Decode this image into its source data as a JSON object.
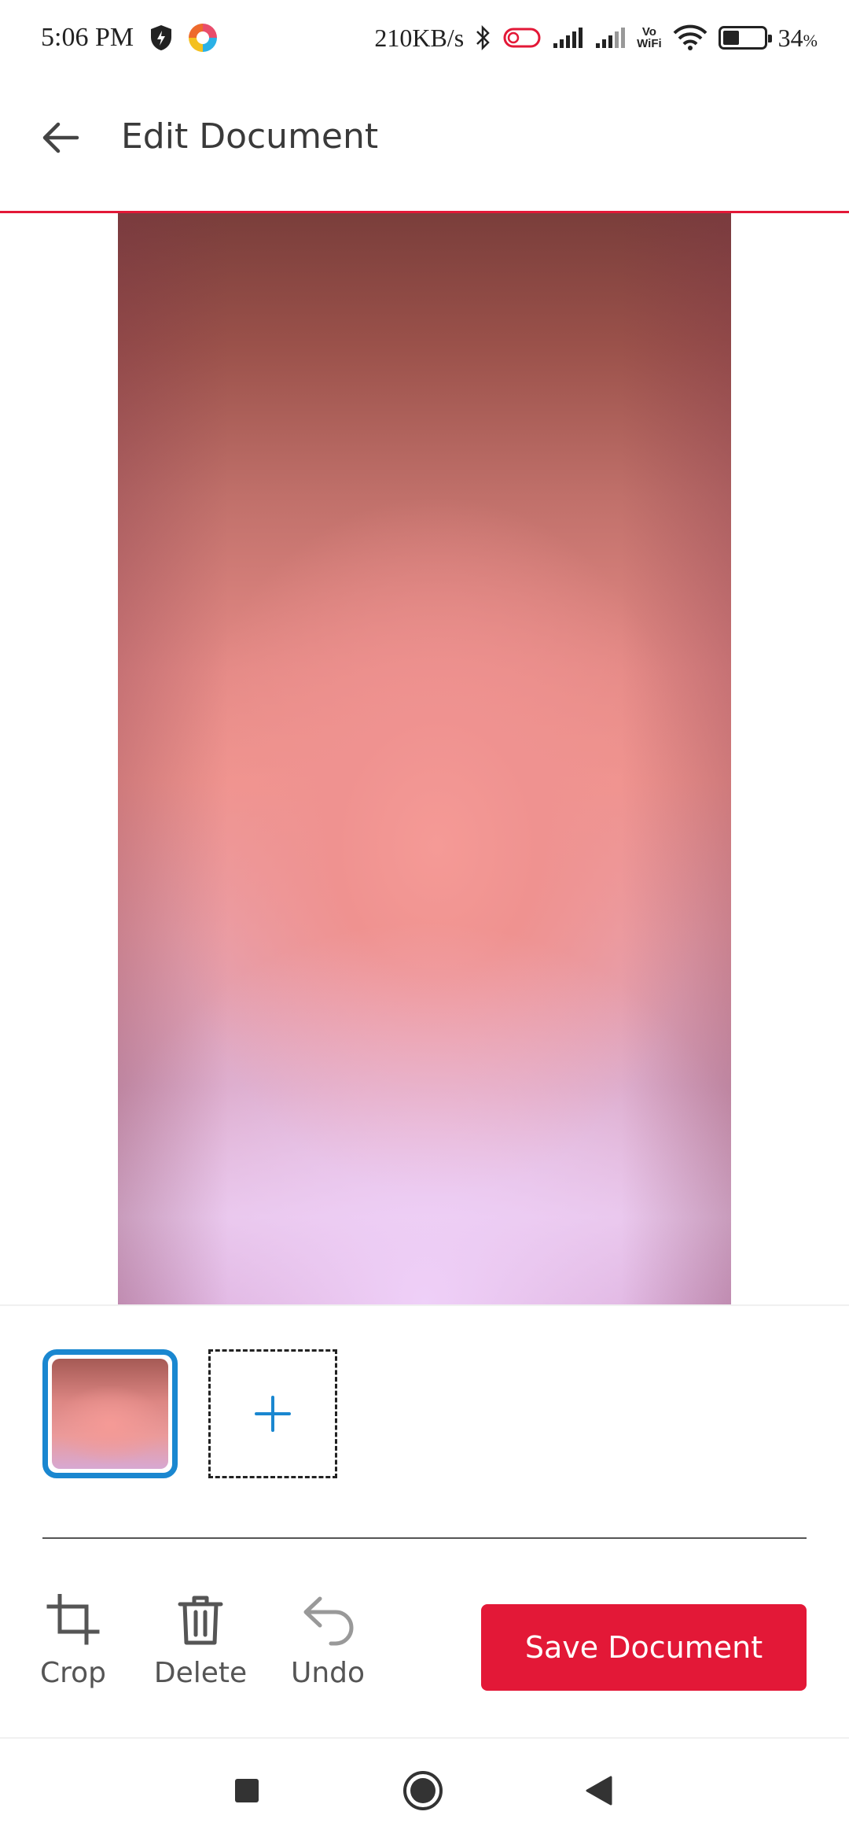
{
  "status_bar": {
    "time": "5:06 PM",
    "network_speed": "210KB/s",
    "vowifi_line1": "Vo",
    "vowifi_line2": "WiFi",
    "battery_percent": "34",
    "battery_percent_sign": "%",
    "icons": [
      "shield-icon",
      "app-icon",
      "bluetooth-icon",
      "toggle-icon",
      "signal-icon",
      "signal-icon",
      "vowifi-icon",
      "wifi-icon",
      "battery-icon"
    ]
  },
  "app_bar": {
    "title": "Edit Document",
    "back_icon": "arrow-left-icon"
  },
  "pages": {
    "selected_index": 0,
    "add_icon": "plus-icon"
  },
  "toolbar": {
    "crop_label": "Crop",
    "delete_label": "Delete",
    "undo_label": "Undo",
    "save_label": "Save Document"
  },
  "nav_bar": {
    "icons": [
      "recent-apps-icon",
      "home-icon",
      "back-icon"
    ]
  },
  "colors": {
    "accent": "#e31837",
    "selection": "#1a87d0"
  }
}
